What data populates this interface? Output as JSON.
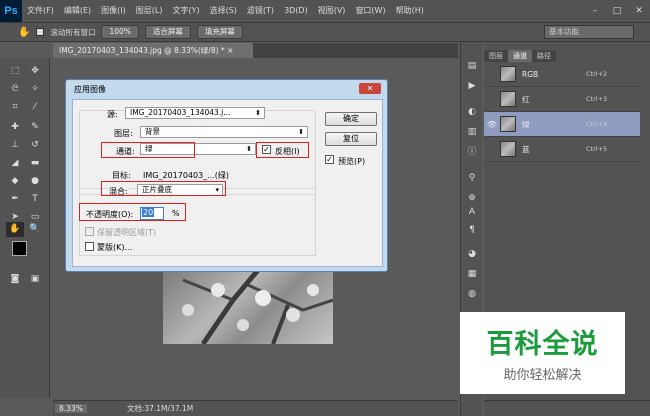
{
  "app": {
    "logo": "Ps",
    "menus": [
      "文件(F)",
      "编辑(E)",
      "图像(I)",
      "图层(L)",
      "文字(Y)",
      "选择(S)",
      "滤镜(T)",
      "3D(D)",
      "视图(V)",
      "窗口(W)",
      "帮助(H)"
    ],
    "win_min": "–",
    "win_max": "□",
    "win_close": "✕"
  },
  "options": {
    "scroll_all": "滚动所有窗口",
    "zoom_btn": "100%",
    "fit_btn": "适合屏幕",
    "fill_btn": "填充屏幕",
    "workspace": "基本功能"
  },
  "doc": {
    "tab": "IMG_20170403_134043.jpg @ 8.33%(绿/8) *",
    "tab_close": "×"
  },
  "status": {
    "zoom": "8.33%",
    "doc_size": "文档:37.1M/37.1M"
  },
  "panel": {
    "tabs": [
      "图层",
      "通道",
      "路径"
    ],
    "channels": [
      {
        "name": "RGB",
        "shortcut": "Ctrl+2",
        "visible": false
      },
      {
        "name": "红",
        "shortcut": "Ctrl+3",
        "visible": false
      },
      {
        "name": "绿",
        "shortcut": "Ctrl+4",
        "visible": true
      },
      {
        "name": "蓝",
        "shortcut": "Ctrl+5",
        "visible": false
      }
    ],
    "eye": "👁"
  },
  "dialog": {
    "title": "应用图像",
    "close": "✕",
    "source_label": "源:",
    "source_value": "IMG_20170403_134043.j...",
    "layer_label": "图层:",
    "layer_value": "背景",
    "channel_label": "通道:",
    "channel_value": "绿",
    "invert_label": "反相(I)",
    "target_label": "目标:",
    "target_value": "IMG_20170403_...(绿)",
    "blend_label": "混合:",
    "blend_value": "正片叠底",
    "opacity_label": "不透明度(O):",
    "opacity_value": "20",
    "opacity_unit": "%",
    "preserve_label": "保留透明区域(T)",
    "mask_label": "蒙版(K)...",
    "ok": "确定",
    "reset": "复位",
    "preview": "预览(P)",
    "check": "✓",
    "arrow": "⬍",
    "dd": "▾"
  },
  "watermark": {
    "title": "百科全说",
    "subtitle": "助你轻松解决"
  }
}
